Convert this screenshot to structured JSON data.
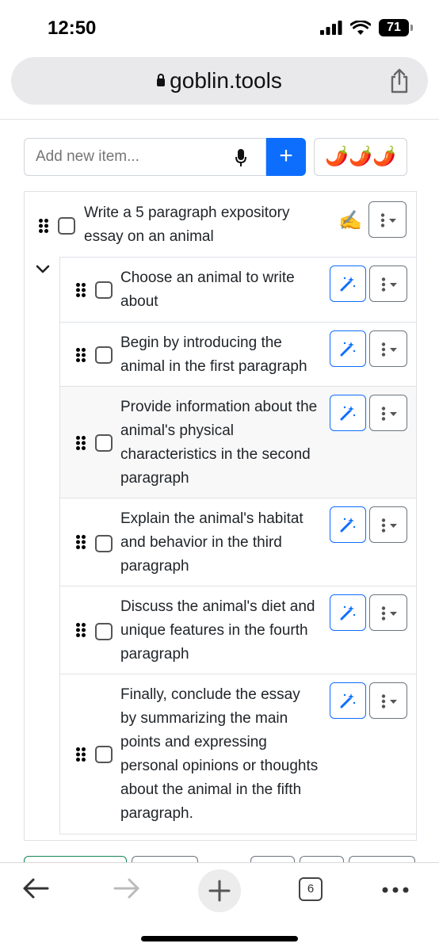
{
  "status_bar": {
    "time": "12:50",
    "battery": "71"
  },
  "browser": {
    "url": "goblin.tools",
    "tab_count": "6"
  },
  "add_item": {
    "placeholder": "Add new item...",
    "add_label": "+",
    "spiciness": "🌶️🌶️🌶️"
  },
  "main_task": {
    "text": "Write a 5 paragraph expository essay on an animal",
    "emoji": "✍️"
  },
  "subtasks": [
    {
      "text": "Choose an animal to write about"
    },
    {
      "text": "Begin by introducing the animal in the first paragraph"
    },
    {
      "text": "Provide information about the animal's physical characteristics in the second paragraph"
    },
    {
      "text": "Explain the animal's habitat and behavior in the third paragraph"
    },
    {
      "text": "Discuss the animal's diet and unique features in the fourth paragraph"
    },
    {
      "text": "Finally, conclude the essay by summarizing the main points and expressing personal opinions or thoughts about the animal in the fifth paragraph."
    }
  ],
  "colors": {
    "accent": "#0d6efd",
    "border": "#dee2e6",
    "highlight_row": "#f8f8f8"
  },
  "icons": [
    "signal-icon",
    "wifi-icon",
    "battery-icon",
    "lock-icon",
    "share-icon",
    "mic-icon",
    "drag-handle-icon",
    "magic-wand-icon",
    "kebab-menu-icon",
    "chevron-down-icon",
    "back-arrow-icon",
    "forward-arrow-icon",
    "new-tab-icon",
    "more-icon"
  ]
}
